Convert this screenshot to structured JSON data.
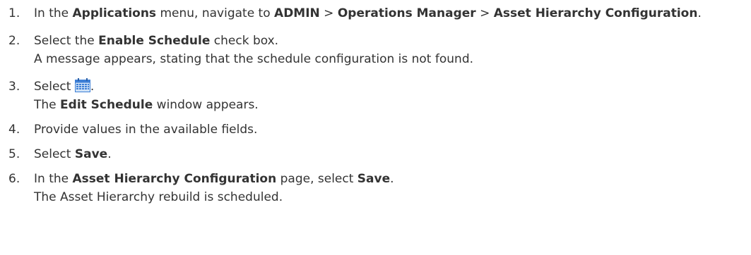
{
  "steps": [
    {
      "number": "1.",
      "t1": "In the ",
      "b1": "Applications",
      "t2": " menu, navigate to ",
      "b2": "ADMIN",
      "t3": " > ",
      "b3": "Operations Manager",
      "t4": " > ",
      "b4": "Asset Hierarchy Configuration",
      "t5": "."
    },
    {
      "number": "2.",
      "t1": "Select the ",
      "b1": "Enable Schedule",
      "t2": " check box.",
      "result": "A message appears, stating that the schedule configuration is not found."
    },
    {
      "number": "3.",
      "t1": "Select ",
      "icon": "calendar-schedule-icon",
      "t2": ".",
      "result_b": "Edit Schedule",
      "result_t": " window appears.",
      "result_pre": "The "
    },
    {
      "number": "4.",
      "t1": "Provide values in the available fields."
    },
    {
      "number": "5.",
      "t1": "Select ",
      "b1": "Save",
      "t2": "."
    },
    {
      "number": "6.",
      "t1": "In the ",
      "b1": "Asset Hierarchy Configuration",
      "t2": " page, select ",
      "b2": "Save",
      "t3": ".",
      "result": "The Asset Hierarchy rebuild is scheduled."
    }
  ],
  "colors": {
    "text": "#333333",
    "icon_blue": "#3d7fd6",
    "icon_light": "#cfe2f7"
  }
}
